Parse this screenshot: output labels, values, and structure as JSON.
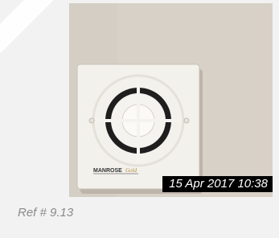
{
  "photo": {
    "timestamp": "15 Apr 2017 10:38",
    "brand_text": "MANROSE",
    "brand_sub": "Gold"
  },
  "caption": {
    "ref": "Ref # 9.13"
  }
}
